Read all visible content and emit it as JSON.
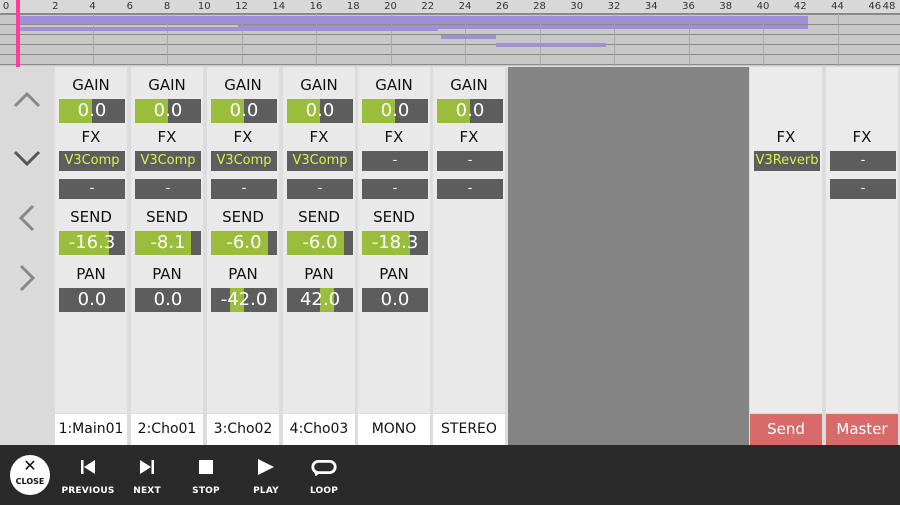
{
  "timeline": {
    "ruler_labels": [
      "0",
      "2",
      "4",
      "6",
      "8",
      "10",
      "12",
      "14",
      "16",
      "18",
      "20",
      "22",
      "24",
      "26",
      "28",
      "30",
      "32",
      "34",
      "36",
      "38",
      "40",
      "42",
      "44",
      "46",
      "48"
    ],
    "clip_color": "#9f8fd6",
    "playhead_color": "#ff3c9c"
  },
  "labels": {
    "gain": "GAIN",
    "fx": "FX",
    "send": "SEND",
    "pan": "PAN"
  },
  "channels": [
    {
      "gain": "0.0",
      "fx1": "V3Comp",
      "fx2": "-",
      "send": "-16.3",
      "send_level": 0.75,
      "pan": "0.0",
      "name": "1:Main01"
    },
    {
      "gain": "0.0",
      "fx1": "V3Comp",
      "fx2": "-",
      "send": "-8.1",
      "send_level": 0.85,
      "pan": "0.0",
      "name": "2:Cho01"
    },
    {
      "gain": "0.0",
      "fx1": "V3Comp",
      "fx2": "-",
      "send": "-6.0",
      "send_level": 0.87,
      "pan": "-42.0",
      "pan_level": -0.42,
      "name": "3:Cho02"
    },
    {
      "gain": "0.0",
      "fx1": "V3Comp",
      "fx2": "-",
      "send": "-6.0",
      "send_level": 0.87,
      "pan": "42.0",
      "pan_level": 0.42,
      "name": "4:Cho03"
    },
    {
      "gain": "0.0",
      "fx1": "-",
      "fx2": "-",
      "send": "-18.3",
      "send_level": 0.72,
      "pan": "0.0",
      "name": "MONO"
    },
    {
      "gain": "0.0",
      "fx1": "-",
      "fx2": "-",
      "name": "STEREO"
    }
  ],
  "returns": [
    {
      "fx1": "V3Reverb",
      "name": "Send"
    },
    {
      "fx1": "-",
      "fx2": "-",
      "name": "Master"
    }
  ],
  "transport": {
    "close": "CLOSE",
    "previous": "PREVIOUS",
    "next": "NEXT",
    "stop": "STOP",
    "play": "PLAY",
    "loop": "LOOP"
  },
  "colors": {
    "level_fill": "#9bbd3c",
    "fx_active": "#d8f24a",
    "return_bar": "#d96a6a"
  }
}
